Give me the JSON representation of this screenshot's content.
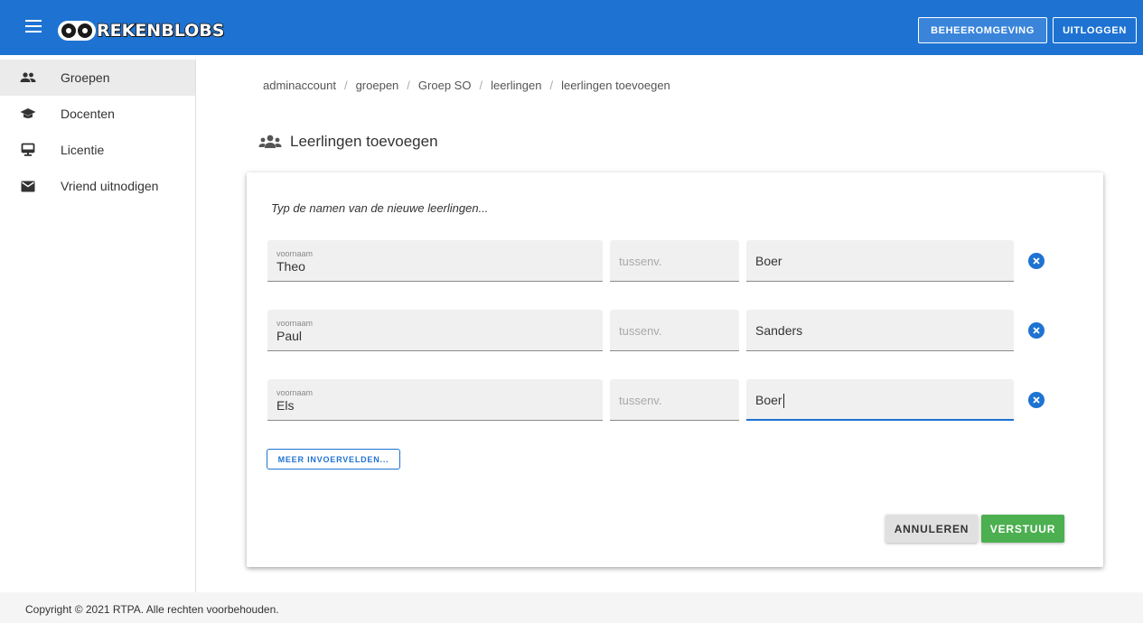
{
  "header": {
    "logo_text": "REKENBLOBS",
    "buttons": {
      "admin": "BEHEEROMGEVING",
      "logout": "UITLOGGEN"
    }
  },
  "sidebar": {
    "items": [
      {
        "label": "Groepen",
        "icon": "group-icon",
        "active": true
      },
      {
        "label": "Docenten",
        "icon": "school-icon",
        "active": false
      },
      {
        "label": "Licentie",
        "icon": "monitor-icon",
        "active": false
      },
      {
        "label": "Vriend uitnodigen",
        "icon": "mail-icon",
        "active": false
      }
    ]
  },
  "breadcrumb": [
    "adminaccount",
    "groepen",
    "Groep SO",
    "leerlingen",
    "leerlingen toevoegen"
  ],
  "page": {
    "title": "Leerlingen toevoegen",
    "instruction": "Typ de namen van de nieuwe leerlingen..."
  },
  "form": {
    "rows": [
      {
        "voornaam_label": "voornaam",
        "voornaam": "Theo",
        "tussenvoegsel_placeholder": "tussenv.",
        "achternaam": "Boer"
      },
      {
        "voornaam_label": "voornaam",
        "voornaam": "Paul",
        "tussenvoegsel_placeholder": "tussenv.",
        "achternaam": "Sanders"
      },
      {
        "voornaam_label": "voornaam",
        "voornaam": "Els",
        "tussenvoegsel_placeholder": "tussenv.",
        "achternaam": "Boer"
      }
    ],
    "more_button": "MEER INVOERVELDEN...",
    "cancel_button": "ANNULEREN",
    "submit_button": "VERSTUUR"
  },
  "footer": {
    "copyright": "Copyright © 2021 RTPA. Alle rechten voorbehouden."
  },
  "colors": {
    "primary": "#1e73d2",
    "success": "#4caf50",
    "cancel": "#e0e0e0"
  }
}
